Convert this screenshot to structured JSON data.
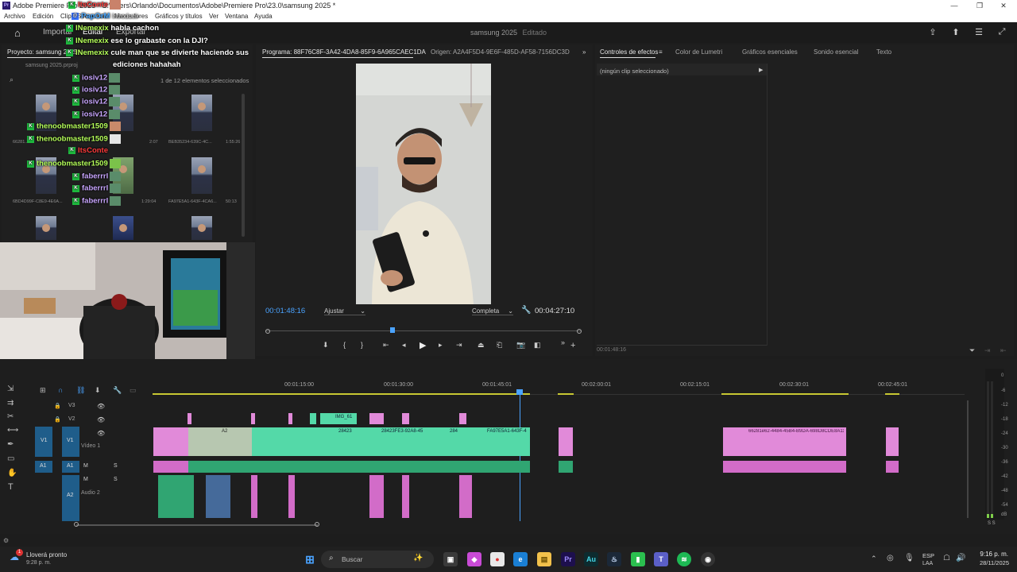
{
  "window": {
    "title": "Adobe Premiere Pro 2025 - C:\\Users\\Orlando\\Documentos\\Adobe\\Premiere Pro\\23.0\\samsung 2025 *",
    "app_icon": "Pr"
  },
  "menu": [
    "Archivo",
    "Edición",
    "Clip",
    "Secuencia",
    "Marcadores",
    "Gráficos y títulos",
    "Ver",
    "Ventana",
    "Ayuda"
  ],
  "header": {
    "workspaces": [
      "Importar",
      "Editar",
      "Exportar"
    ],
    "project_name": "samsung 2025",
    "status": "Editado"
  },
  "project": {
    "tab": "Proyecto: samsung 2025",
    "file": "samsung 2025.prproj",
    "selection": "1 de 12 elementos seleccionados",
    "clips": [
      {
        "name": "66281...",
        "duration": "2:07"
      },
      {
        "name": "BEB35234-639C-4C...",
        "duration": "1:55:26"
      },
      {
        "name": "6BD4D99F-C8E9-4E6A...",
        "duration": "1:29:04"
      },
      {
        "name": "FA97E5A1-643F-4CA6...",
        "duration": "50:13"
      }
    ]
  },
  "chat": [
    {
      "user": "ItsConte",
      "msg": "",
      "color": "#ff3b3b"
    },
    {
      "user": "PapOrM",
      "msg": "Introducir",
      "color": "#4aa8ff"
    },
    {
      "user": "INemexix",
      "msg": "habla cachon",
      "color": "#b5ff5a"
    },
    {
      "user": "INemexix",
      "msg": "ese lo grabaste con la DJI?",
      "color": "#b5ff5a"
    },
    {
      "user": "INemexix",
      "msg": "cule man que se divierte haciendo sus",
      "color": "#b5ff5a"
    },
    {
      "user": "",
      "msg": "ediciones hahahah",
      "color": "#ffffff"
    },
    {
      "user": "iosiv12",
      "msg": "",
      "color": "#c9a6ff"
    },
    {
      "user": "iosiv12",
      "msg": "",
      "color": "#c9a6ff"
    },
    {
      "user": "iosiv12",
      "msg": "",
      "color": "#c9a6ff"
    },
    {
      "user": "iosiv12",
      "msg": "",
      "color": "#c9a6ff"
    },
    {
      "user": "thenoobmaster1509",
      "msg": "",
      "color": "#b5ff5a"
    },
    {
      "user": "thenoobmaster1509",
      "msg": "",
      "color": "#b5ff5a"
    },
    {
      "user": "ItsConte",
      "msg": "",
      "color": "#ff3b3b"
    },
    {
      "user": "thenoobmaster1509",
      "msg": "",
      "color": "#b5ff5a"
    },
    {
      "user": "faberrrl",
      "msg": "",
      "color": "#c9a6ff"
    },
    {
      "user": "faberrrl",
      "msg": "",
      "color": "#c9a6ff"
    },
    {
      "user": "faberrrl",
      "msg": "",
      "color": "#c9a6ff"
    }
  ],
  "program": {
    "tab": "Programa: 88F76C8F-3A42-4DA8-85F9-6A965CAEC1DA",
    "source_tab": "Origen: A2A4F5D4-9E6F-485D-AF58-7156DC3D07FA",
    "timecode": "00:01:48:16",
    "fit": "Ajustar",
    "quality": "Completa",
    "duration": "00:04:27:10",
    "playhead_fraction": 0.4
  },
  "effects": {
    "tabs": [
      "Controles de efectos",
      "Color de Lumetri",
      "Gráficos esenciales",
      "Sonido esencial",
      "Texto"
    ],
    "empty": "(ningún clip seleccionado)",
    "timecode": "00:01:48:16"
  },
  "timeline": {
    "ruler": [
      "00:01:15:00",
      "00:01:30:00",
      "00:01:45:01",
      "00:02:00:01",
      "00:02:15:01",
      "00:02:30:01",
      "00:02:45:01"
    ],
    "tracks": {
      "v3": "V3",
      "v2": "V2",
      "v1": "V1",
      "v1_name": "Vídeo 1",
      "a1": "A1",
      "a2": "A2",
      "a2_name": "Audio 2"
    },
    "clip_labels": [
      "IMG_61",
      "A2",
      "28423",
      "28423FE3-92A8-45",
      "284",
      "FA97E5A1-643F-4",
      "66281e62-4484-45B4-B9DA-698D8CDE8A11"
    ],
    "meter_labels": [
      "0",
      "-6",
      "-12",
      "-18",
      "-24",
      "-30",
      "-36",
      "-42",
      "-48",
      "-54",
      "dB"
    ],
    "meter_solo": "S S"
  },
  "taskbar": {
    "weather_title": "Lloverá pronto",
    "weather_time": "9:28 p. m.",
    "search": "Buscar",
    "lang": "ESP",
    "lang2": "LAA",
    "time": "9:16 p. m.",
    "date": "28/11/2025"
  }
}
